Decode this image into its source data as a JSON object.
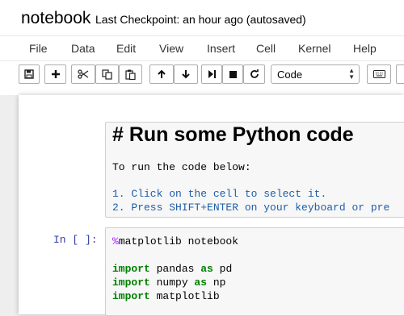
{
  "header": {
    "notebook_name": "notebook",
    "checkpoint": "Last Checkpoint: an hour ago (autosaved)"
  },
  "menu": [
    "File",
    "Data",
    "Edit",
    "View",
    "Insert",
    "Cell",
    "Kernel",
    "Help"
  ],
  "toolbar": {
    "cell_type": "Code",
    "icons": [
      "save-icon",
      "plus-icon",
      "cut-icon",
      "copy-icon",
      "paste-icon",
      "arrow-up-icon",
      "arrow-down-icon",
      "step-icon",
      "stop-icon",
      "restart-icon",
      "keyboard-icon"
    ]
  },
  "markdown_cell": {
    "heading": "# Run some Python code",
    "intro": "To run the code below:",
    "step1": "1. Click on the cell to select it.",
    "step2": "2. Press SHIFT+ENTER on your keyboard or pre"
  },
  "code_cell": {
    "prompt": "In [ ]:",
    "magic_char": "%",
    "magic_rest": "matplotlib notebook",
    "imports": [
      {
        "kw": "import",
        "mod": " pandas ",
        "as": "as",
        "alias": " pd"
      },
      {
        "kw": "import",
        "mod": " numpy ",
        "as": "as",
        "alias": " np"
      },
      {
        "kw": "import",
        "mod": " matplotlib",
        "as": "",
        "alias": ""
      }
    ]
  }
}
